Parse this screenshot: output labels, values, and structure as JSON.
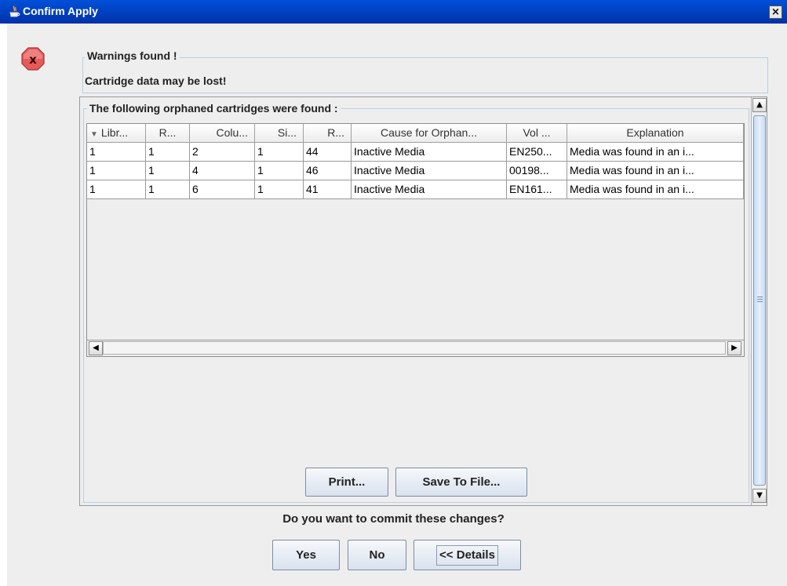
{
  "window": {
    "title": "Confirm Apply",
    "close_label": "×"
  },
  "warnings": {
    "group_title": "Warnings found !",
    "message": "Cartridge data may be lost!"
  },
  "orphans": {
    "group_title": "The following orphaned cartridges were found :",
    "columns": [
      "Libr...",
      "R...",
      "Colu...",
      "Si...",
      "R...",
      "Cause for Orphan...",
      "Vol ...",
      "Explanation"
    ],
    "sorted_column_indicator": "▼",
    "rows": [
      [
        "1",
        "1",
        "2",
        "1",
        "44",
        "Inactive Media",
        "EN250...",
        "Media was found in an i..."
      ],
      [
        "1",
        "1",
        "4",
        "1",
        "46",
        "Inactive Media",
        "00198...",
        "Media was found in an i..."
      ],
      [
        "1",
        "1",
        "6",
        "1",
        "41",
        "Inactive Media",
        "EN161...",
        "Media was found in an i..."
      ]
    ],
    "print_label": "Print...",
    "save_label": "Save To File..."
  },
  "prompt": {
    "question": "Do you want to commit these changes?",
    "yes_label": "Yes",
    "no_label": "No",
    "details_label": "<< Details"
  },
  "colors": {
    "titlebar": "#0046c8",
    "error_icon": "#e84848",
    "group_border": "#b8cfe5"
  }
}
